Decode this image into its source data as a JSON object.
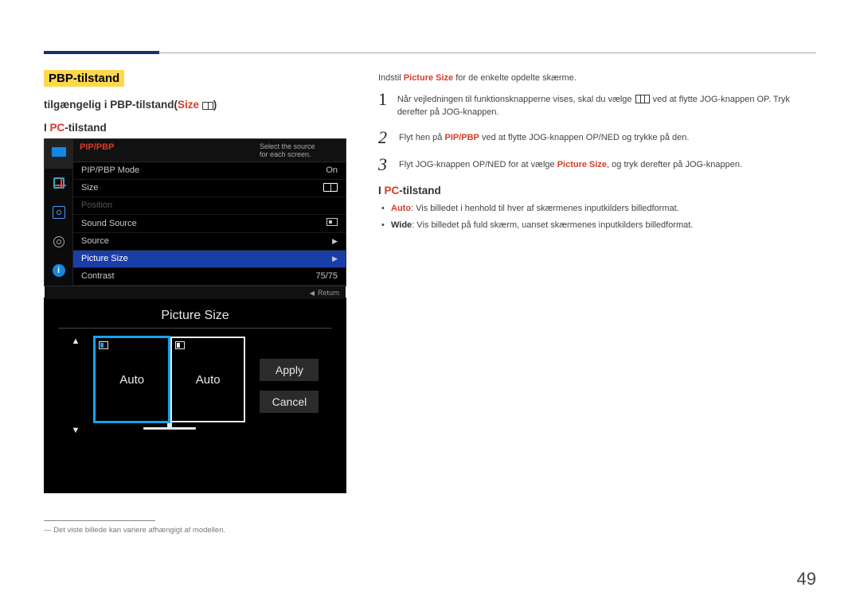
{
  "badge": "PBP-tilstand",
  "subtitle_prefix": "tilgængelig i PBP-tilstand(",
  "subtitle_size_label": "Size",
  "subtitle_suffix": ")",
  "left_heading_prefix": "I ",
  "left_heading_pc": "PC",
  "left_heading_suffix": "-tilstand",
  "osd1": {
    "header_title": "PIP/PBP",
    "hint_line1": "Select the source",
    "hint_line2": "for each screen.",
    "rows": {
      "mode_label": "PIP/PBP Mode",
      "mode_value": "On",
      "size_label": "Size",
      "position_label": "Position",
      "sound_label": "Sound Source",
      "source_label": "Source",
      "picture_label": "Picture Size",
      "contrast_label": "Contrast",
      "contrast_value": "75/75"
    },
    "return_label": "Return"
  },
  "osd2": {
    "title": "Picture Size",
    "left_half": "Auto",
    "right_half": "Auto",
    "apply": "Apply",
    "cancel": "Cancel"
  },
  "footnote": "Det viste billede kan variere afhængigt af modellen.",
  "right": {
    "intro_pre": "Indstil ",
    "intro_b": "Picture Size",
    "intro_post": " for de enkelte opdelte skærme.",
    "step1_a": "Når vejledningen til funktionsknapperne vises, skal du vælge ",
    "step1_b": " ved at flytte JOG-knappen OP. Tryk derefter på JOG-knappen.",
    "step2_a": "Flyt hen på ",
    "step2_bold": "PIP/PBP",
    "step2_b": " ved at flytte JOG-knappen OP/NED og trykke på den.",
    "step3_a": "Flyt JOG-knappen OP/NED for at vælge ",
    "step3_bold": "Picture Size",
    "step3_b": ", og tryk derefter på JOG-knappen.",
    "sub_prefix": "I ",
    "sub_pc": "PC",
    "sub_suffix": "-tilstand",
    "bullet_auto_label": "Auto",
    "bullet_auto_text": ": Vis billedet i henhold til hver af skærmenes inputkilders billedformat.",
    "bullet_wide_label": "Wide",
    "bullet_wide_text": ": Vis billedet på fuld skærm, uanset skærmenes inputkilders billedformat."
  },
  "page_number": "49"
}
